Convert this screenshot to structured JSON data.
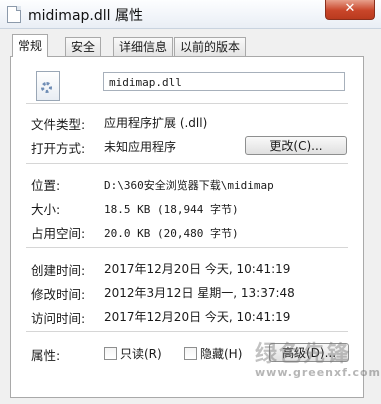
{
  "window": {
    "title": "midimap.dll 属性",
    "close_label": "✕"
  },
  "tabs": [
    {
      "label": "常规"
    },
    {
      "label": "安全"
    },
    {
      "label": "详细信息"
    },
    {
      "label": "以前的版本"
    }
  ],
  "file_name": "midimap.dll",
  "fields": {
    "type": {
      "label": "文件类型:",
      "value": "应用程序扩展 (.dll)"
    },
    "opens_with": {
      "label": "打开方式:",
      "value": "未知应用程序",
      "button": "更改(C)..."
    },
    "location": {
      "label": "位置:",
      "value": "D:\\360安全浏览器下载\\midimap"
    },
    "size": {
      "label": "大小:",
      "value": "18.5 KB (18,944 字节)"
    },
    "size_on_disk": {
      "label": "占用空间:",
      "value": "20.0 KB (20,480 字节)"
    },
    "created": {
      "label": "创建时间:",
      "value": "2017年12月20日 今天, 10:41:19"
    },
    "modified": {
      "label": "修改时间:",
      "value": "2012年3月12日 星期一, 13:37:48"
    },
    "accessed": {
      "label": "访问时间:",
      "value": "2017年12月20日 今天, 10:41:19"
    },
    "attributes": {
      "label": "属性:",
      "readonly": "只读(R)",
      "hidden": "隐藏(H)",
      "advanced_button": "高级(D)..."
    }
  },
  "watermark": {
    "text": "绿色先锋",
    "url": "www.greenxf.com"
  }
}
